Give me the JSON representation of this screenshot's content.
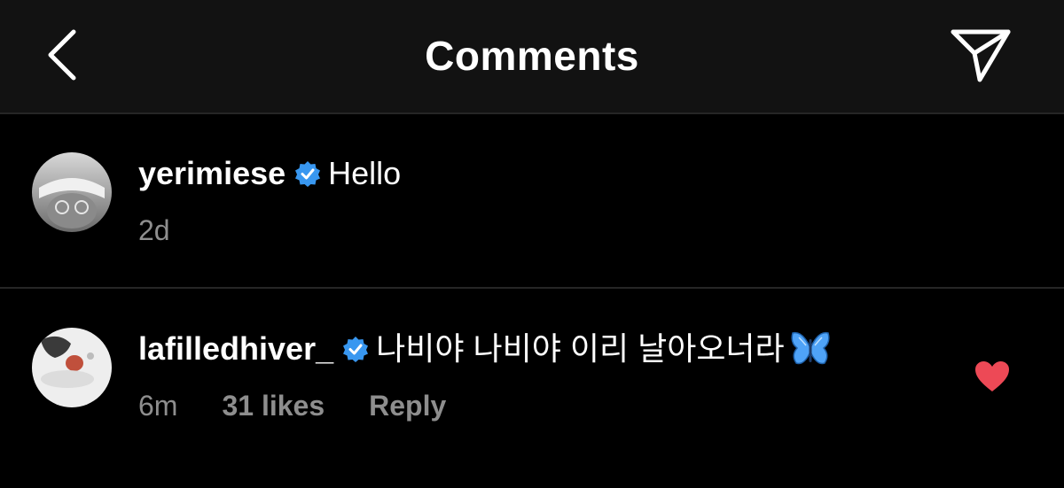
{
  "header": {
    "title": "Comments",
    "back_icon": "chevron-left-icon",
    "send_icon": "paper-plane-icon"
  },
  "comments": [
    {
      "username": "yerimiese",
      "verified": true,
      "text": "Hello",
      "timestamp": "2d"
    },
    {
      "username": "lafilledhiver_",
      "verified": true,
      "text": "나비야 나비야 이리 날아오너라",
      "emoji": "butterfly",
      "timestamp": "6m",
      "likes": "31 likes",
      "reply_label": "Reply",
      "liked": true
    }
  ],
  "colors": {
    "background": "#000000",
    "header_bg": "#121212",
    "divider": "#262626",
    "meta_text": "#8e8e8e",
    "verified_blue": "#3897f0",
    "heart_red": "#ed4956"
  }
}
